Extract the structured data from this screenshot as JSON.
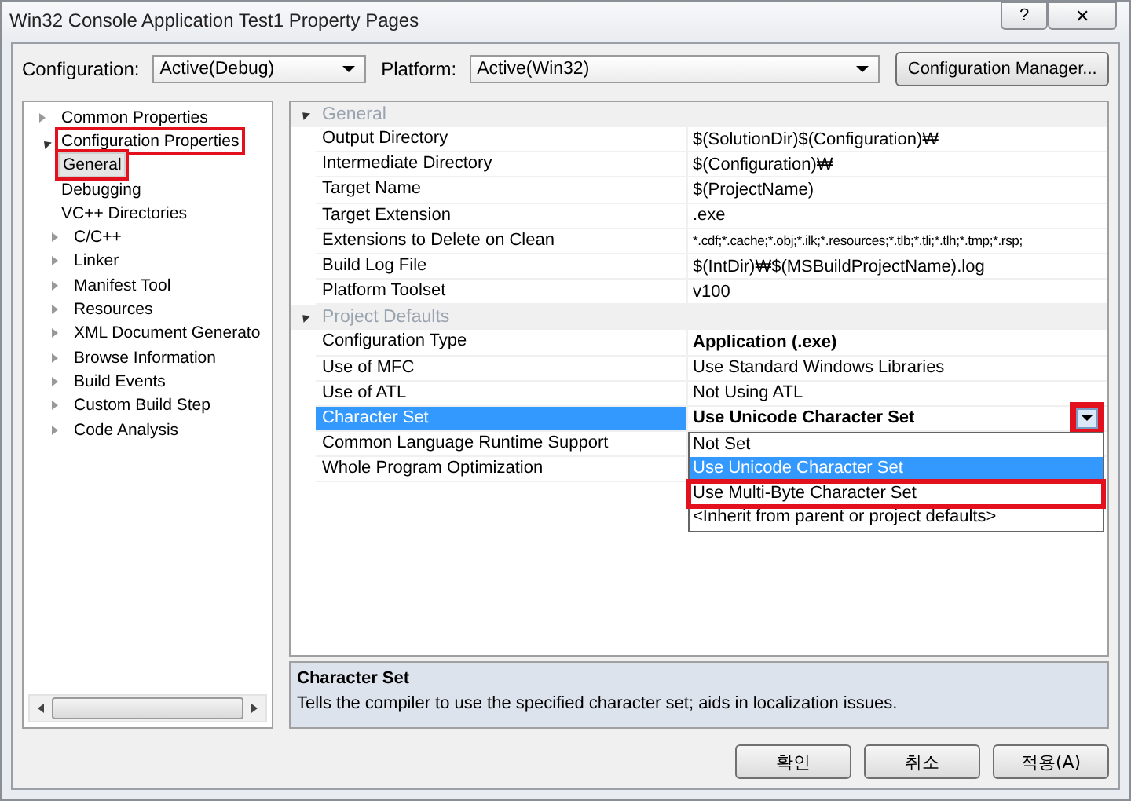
{
  "window": {
    "title": "Win32 Console Application Test1 Property Pages",
    "help_button": "?",
    "close_button": "✕"
  },
  "toolbar": {
    "configuration_label": "Configuration:",
    "configuration": "Active(Debug)",
    "platform_label": "Platform:",
    "platform": "Active(Win32)",
    "manager_button": "Configuration Manager..."
  },
  "tree": [
    {
      "label": "Common Properties",
      "kind": "folder",
      "expanded": false,
      "highlighted": false
    },
    {
      "label": "Configuration Properties",
      "kind": "folder",
      "expanded": true,
      "highlighted": true,
      "children": [
        {
          "label": "General",
          "kind": "leaf",
          "selected": true,
          "highlighted": true
        },
        {
          "label": "Debugging",
          "kind": "leaf",
          "selected": false,
          "highlighted": false
        },
        {
          "label": "VC++ Directories",
          "kind": "leaf",
          "selected": false,
          "highlighted": false
        },
        {
          "label": "C/C++",
          "kind": "folder",
          "expanded": false,
          "selected": false,
          "highlighted": false
        },
        {
          "label": "Linker",
          "kind": "folder",
          "expanded": false,
          "selected": false,
          "highlighted": false
        },
        {
          "label": "Manifest Tool",
          "kind": "folder",
          "expanded": false,
          "selected": false,
          "highlighted": false
        },
        {
          "label": "Resources",
          "kind": "folder",
          "expanded": false,
          "selected": false,
          "highlighted": false
        },
        {
          "label": "XML Document Generato",
          "kind": "folder",
          "expanded": false,
          "selected": false,
          "highlighted": false
        },
        {
          "label": "Browse Information",
          "kind": "folder",
          "expanded": false,
          "selected": false,
          "highlighted": false
        },
        {
          "label": "Build Events",
          "kind": "folder",
          "expanded": false,
          "selected": false,
          "highlighted": false
        },
        {
          "label": "Custom Build Step",
          "kind": "folder",
          "expanded": false,
          "selected": false,
          "highlighted": false
        },
        {
          "label": "Code Analysis",
          "kind": "folder",
          "expanded": false,
          "selected": false,
          "highlighted": false
        }
      ]
    }
  ],
  "grid": [
    {
      "category": "General",
      "expanded": true,
      "rows": [
        {
          "name": "Output Directory",
          "value": "$(SolutionDir)$(Configuration)₩",
          "bold": false,
          "selected": false
        },
        {
          "name": "Intermediate Directory",
          "value": "$(Configuration)₩",
          "bold": false,
          "selected": false
        },
        {
          "name": "Target Name",
          "value": "$(ProjectName)",
          "bold": false,
          "selected": false
        },
        {
          "name": "Target Extension",
          "value": ".exe",
          "bold": false,
          "selected": false
        },
        {
          "name": "Extensions to Delete on Clean",
          "value": "*.cdf;*.cache;*.obj;*.ilk;*.resources;*.tlb;*.tli;*.tlh;*.tmp;*.rsp;",
          "bold": false,
          "selected": false
        },
        {
          "name": "Build Log File",
          "value": "$(IntDir)₩$(MSBuildProjectName).log",
          "bold": false,
          "selected": false
        },
        {
          "name": "Platform Toolset",
          "value": "v100",
          "bold": false,
          "selected": false
        }
      ]
    },
    {
      "category": "Project Defaults",
      "expanded": true,
      "rows": [
        {
          "name": "Configuration Type",
          "value": "Application (.exe)",
          "bold": true,
          "selected": false
        },
        {
          "name": "Use of MFC",
          "value": "Use Standard Windows Libraries",
          "bold": false,
          "selected": false
        },
        {
          "name": "Use of ATL",
          "value": "Not Using ATL",
          "bold": false,
          "selected": false
        },
        {
          "name": "Character Set",
          "value": "Use Unicode Character Set",
          "bold": true,
          "selected": true,
          "dropdown_highlighted": true
        },
        {
          "name": "Common Language Runtime Support",
          "selected": false
        },
        {
          "name": "Whole Program Optimization",
          "selected": false
        }
      ]
    }
  ],
  "dropdown": {
    "options": [
      {
        "label": "Not Set",
        "selected": false,
        "highlighted": false
      },
      {
        "label": "Use Unicode Character Set",
        "selected": true,
        "highlighted": false
      },
      {
        "label": "Use Multi-Byte Character Set",
        "selected": false,
        "highlighted": true
      },
      {
        "label": "<Inherit from parent or project defaults>",
        "selected": false,
        "highlighted": false
      }
    ]
  },
  "description": {
    "title": "Character Set",
    "text": "Tells the compiler to use the specified character set; aids in localization issues."
  },
  "buttons": [
    "확인",
    "취소",
    "적용(A)"
  ]
}
